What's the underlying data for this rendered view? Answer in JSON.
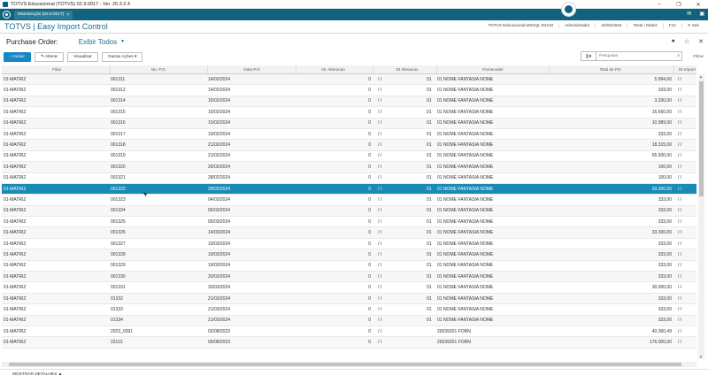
{
  "window": {
    "title": "TOTVS Educacional (TOTVS) 02.9.0017 - Ver. 20.3.2.4",
    "controls": [
      "–",
      "❐",
      "✕"
    ]
  },
  "tabbar": {
    "tab_label": "Manutenção (02.9.0017)",
    "tab_close": "×",
    "mail_icon": "✉",
    "menu_icon": "▣"
  },
  "header": {
    "brand": "TOTVS | Easy Import Control",
    "meta": [
      "TOTVS Educacional MSSQL R2210",
      "Administrador",
      "22/03/2024",
      "Teste / Matriz",
      "F12",
      "✕ Sair"
    ]
  },
  "page": {
    "title": "Purchase Order:",
    "filter": "Exibir Todos"
  },
  "toolbar": {
    "incluir": "+ Incluir",
    "alterar": "✎ Alterar",
    "visualizar": "Visualizar",
    "outras": "Outras Ações ▾",
    "search_placeholder": "Pesquisar",
    "filtros": "Filtrar"
  },
  "columns": [
    "Filial",
    "No. P.O.",
    "Data P.O",
    "Nr. Alteracao",
    "Dt Alteracao",
    "Fornecedor",
    "Total do PO",
    "Dt Import"
  ],
  "rows": [
    [
      "01-MATRIZ",
      "001311",
      "14/02/2024",
      "0",
      "/ /",
      "01",
      "01 NOME FANTASIA NOME",
      "5.994,00",
      "/ /"
    ],
    [
      "01-MATRIZ",
      "001312",
      "14/02/2024",
      "0",
      "/ /",
      "01",
      "01 NOME FANTASIA NOME",
      "333,00",
      "/ /"
    ],
    [
      "01-MATRIZ",
      "001314",
      "15/02/2024",
      "0",
      "/ /",
      "01",
      "01 NOME FANTASIA NOME",
      "3.330,00",
      "/ /"
    ],
    [
      "01-MATRIZ",
      "001315",
      "15/02/2024",
      "0",
      "/ /",
      "01",
      "01 NOME FANTASIA NOME",
      "16.650,00",
      "/ /"
    ],
    [
      "01-MATRIZ",
      "001316",
      "15/02/2024",
      "0",
      "/ /",
      "01",
      "01 NOME FANTASIA NOME",
      "10.989,00",
      "/ /"
    ],
    [
      "01-MATRIZ",
      "001317",
      "19/02/2024",
      "0",
      "/ /",
      "01",
      "01 NOME FANTASIA NOME",
      "333,00",
      "/ /"
    ],
    [
      "01-MATRIZ",
      "001318",
      "21/02/2024",
      "0",
      "/ /",
      "01",
      "01 NOME FANTASIA NOME",
      "18.315,00",
      "/ /"
    ],
    [
      "01-MATRIZ",
      "001319",
      "21/02/2024",
      "0",
      "/ /",
      "01",
      "01 NOME FANTASIA NOME",
      "65.500,00",
      "/ /"
    ],
    [
      "01-MATRIZ",
      "001320",
      "26/02/2024",
      "0",
      "/ /",
      "01",
      "01 NOME FANTASIA NOME",
      "100,00",
      "/ /"
    ],
    [
      "01-MATRIZ",
      "001321",
      "28/02/2024",
      "0",
      "/ /",
      "01",
      "01 NOME FANTASIA NOME",
      "100,00",
      "/ /"
    ],
    [
      "01-MATRIZ",
      "001322",
      "29/02/2024",
      "0",
      "/ /",
      "01",
      "01 NOME FANTASIA NOME",
      "33.300,00",
      "/ /"
    ],
    [
      "01-MATRIZ",
      "001323",
      "04/03/2024",
      "0",
      "/ /",
      "01",
      "01 NOME FANTASIA NOME",
      "333,00",
      "/ /"
    ],
    [
      "01-MATRIZ",
      "001324",
      "05/03/2024",
      "0",
      "/ /",
      "01",
      "01 NOME FANTASIA NOME",
      "333,00",
      "/ /"
    ],
    [
      "01-MATRIZ",
      "001325",
      "05/03/2024",
      "0",
      "/ /",
      "01",
      "01 NOME FANTASIA NOME",
      "333,00",
      "/ /"
    ],
    [
      "01-MATRIZ",
      "001326",
      "14/03/2024",
      "0",
      "/ /",
      "01",
      "01 NOME FANTASIA NOME",
      "33.300,00",
      "/ /"
    ],
    [
      "01-MATRIZ",
      "001327",
      "19/03/2024",
      "0",
      "/ /",
      "01",
      "01 NOME FANTASIA NOME",
      "333,00",
      "/ /"
    ],
    [
      "01-MATRIZ",
      "001328",
      "19/03/2024",
      "0",
      "/ /",
      "01",
      "01 NOME FANTASIA NOME",
      "333,00",
      "/ /"
    ],
    [
      "01-MATRIZ",
      "001329",
      "19/03/2024",
      "0",
      "/ /",
      "01",
      "01 NOME FANTASIA NOME",
      "333,00",
      "/ /"
    ],
    [
      "01-MATRIZ",
      "001330",
      "20/03/2024",
      "0",
      "/ /",
      "01",
      "01 NOME FANTASIA NOME",
      "333,00",
      "/ /"
    ],
    [
      "01-MATRIZ",
      "001331",
      "20/03/2024",
      "0",
      "/ /",
      "01",
      "01 NOME FANTASIA NOME",
      "30.000,00",
      "/ /"
    ],
    [
      "01-MATRIZ",
      "01332",
      "21/03/2024",
      "0",
      "/ /",
      "01",
      "01 NOME FANTASIA NOME",
      "333,00",
      "/ /"
    ],
    [
      "01-MATRIZ",
      "01333",
      "21/03/2024",
      "0",
      "/ /",
      "01",
      "01 NOME FANTASIA NOME",
      "333,00",
      "/ /"
    ],
    [
      "01-MATRIZ",
      "01334",
      "21/03/2024",
      "0",
      "/ /",
      "01",
      "01 NOME FANTASIA NOME",
      "333,00",
      "/ /"
    ],
    [
      "01-MATRIZ",
      "2023_0391",
      "02/08/2023",
      "0",
      "/ /",
      "",
      "20039201 FORN",
      "40.360,49",
      "/ /"
    ],
    [
      "01-MATRIZ",
      "23113",
      "09/08/2023",
      "0",
      "/ /",
      "",
      "20039201 FORN",
      "176.000,00",
      "/ /"
    ]
  ],
  "selected_row": 10,
  "footer": {
    "details": "MOSTRAR DETALHES ▲"
  }
}
